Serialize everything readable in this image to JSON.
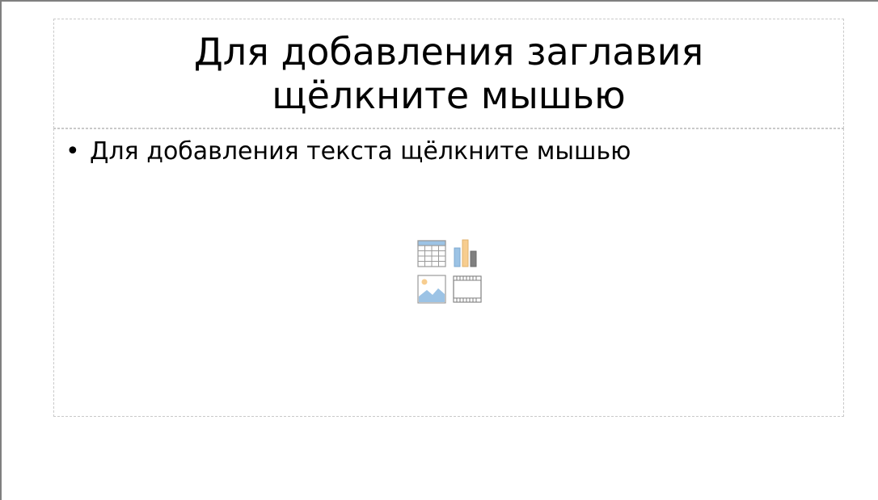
{
  "slide": {
    "title_placeholder": "Для добавления заглавия щёлкните мышью",
    "content_placeholder_bullet": "•",
    "content_placeholder": "Для добавления текста щёлкните мышью"
  },
  "insert_icons": [
    {
      "name": "insert-table-icon"
    },
    {
      "name": "insert-chart-icon"
    },
    {
      "name": "insert-image-icon"
    },
    {
      "name": "insert-video-icon"
    }
  ],
  "colors": {
    "placeholder_border": "#c9c9c9",
    "slide_border": "#7f7f7f",
    "icon_blue": "#9cc3e5",
    "icon_orange": "#f7cd8f",
    "icon_gray": "#808080"
  }
}
